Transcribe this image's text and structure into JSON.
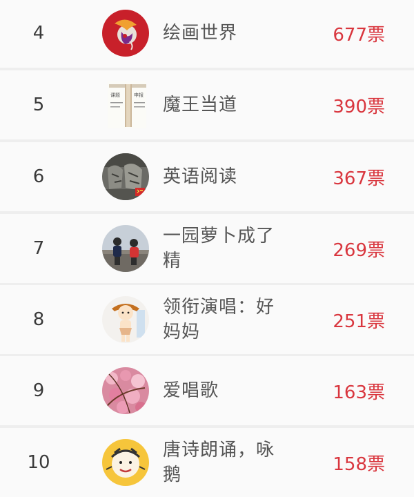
{
  "ranking": {
    "items": [
      {
        "rank": "4",
        "name": "绘画世界",
        "votes": "677票",
        "avatar": "red-art-logo-icon"
      },
      {
        "rank": "5",
        "name": "魔王当道",
        "votes": "390票",
        "avatar": "scroll-document-icon"
      },
      {
        "rank": "6",
        "name": "英语阅读",
        "votes": "367票",
        "avatar": "statue-photo-icon"
      },
      {
        "rank": "7",
        "name": "一园萝卜成了精",
        "votes": "269票",
        "avatar": "children-photo-icon"
      },
      {
        "rank": "8",
        "name": "领衔演唱：好妈妈",
        "votes": "251票",
        "avatar": "cartoon-child-icon"
      },
      {
        "rank": "9",
        "name": "爱唱歌",
        "votes": "163票",
        "avatar": "pink-blossom-icon"
      },
      {
        "rank": "10",
        "name": "唐诗朗诵，咏鹅",
        "votes": "158票",
        "avatar": "cartoon-face-icon"
      }
    ],
    "scroll_text": {
      "left_top": "课题",
      "right_top": "申报"
    },
    "colors": {
      "votes": "#d9363e",
      "rank": "#3a3a3a",
      "name": "#555555",
      "row_bg": "#fafafa",
      "separator": "#eeeeee"
    }
  }
}
